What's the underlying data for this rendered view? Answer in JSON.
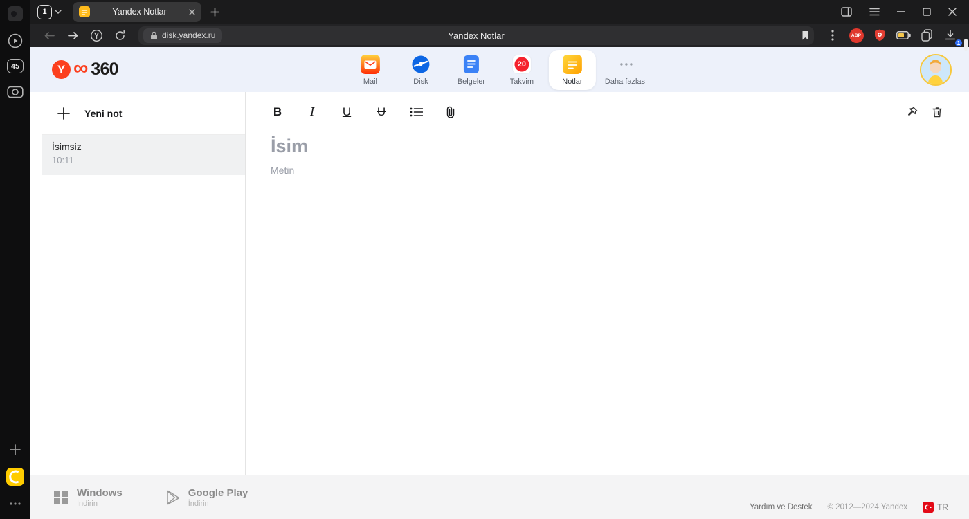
{
  "browser": {
    "sidebar": {
      "tab_count": "45"
    },
    "tabstrip": {
      "tab_counter": "1",
      "tab_title": "Yandex Notlar"
    },
    "navbar": {
      "url": "disk.yandex.ru",
      "page_title": "Yandex Notlar",
      "abp_label": "ABP",
      "download_badge": "1"
    }
  },
  "header": {
    "logo": {
      "letter": "Y",
      "infinity": "∞",
      "text": "360"
    },
    "services": [
      {
        "label": "Mail"
      },
      {
        "label": "Disk"
      },
      {
        "label": "Belgeler"
      },
      {
        "label": "Takvim",
        "badge": "20"
      },
      {
        "label": "Notlar"
      },
      {
        "label": "Daha fazlası"
      }
    ]
  },
  "notes": {
    "new_note_label": "Yeni not",
    "items": [
      {
        "title": "İsimsiz",
        "time": "10:11"
      }
    ]
  },
  "editor": {
    "toolbar": {
      "bold": "B",
      "italic": "I",
      "underline": "U",
      "strikethrough": "U"
    },
    "title_placeholder": "İsim",
    "body_placeholder": "Metin"
  },
  "footer": {
    "windows_title": "Windows",
    "windows_subtitle": "İndirin",
    "gplay_title": "Google Play",
    "gplay_subtitle": "İndirin",
    "help": "Yardım ve Destek",
    "copyright": "© 2012—2024 Yandex",
    "language": "TR"
  },
  "colors": {
    "yandex_red": "#fc3f1d",
    "header_bg": "#edf1fa",
    "calendar_red": "#f5222d",
    "notes_yellow": "#ffb800",
    "download_badge_blue": "#2f6ef6",
    "abp_red": "#e0382d"
  }
}
